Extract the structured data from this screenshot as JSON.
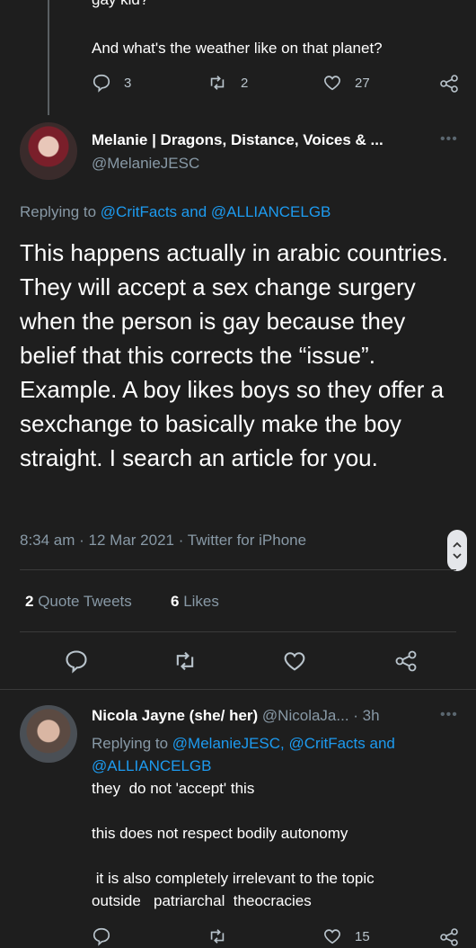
{
  "top_reply": {
    "partial_text": "gay kid?",
    "text": "And what's the weather like on that planet?",
    "replies": "3",
    "retweets": "2",
    "likes": "27"
  },
  "main_tweet": {
    "display_name": "Melanie | Dragons, Distance, Voices & ...",
    "handle": "@MelanieJESC",
    "replying_prefix": "Replying to",
    "replying_to_1": "@CritFacts",
    "replying_and": "and",
    "replying_to_2": "@ALLIANCELGB",
    "body": "This happens actually in arabic countries. They will accept a sex change surgery when the person is gay because they belief that this corrects the “issue”. Example. A boy likes boys so they offer a sexchange to basically make the boy straight. I search an article for you.",
    "timestamp": "8:34 am · 12 Mar 2021 · Twitter for iPhone",
    "quote_count": "2",
    "quote_label": "Quote Tweets",
    "likes_count": "6",
    "likes_label": "Likes"
  },
  "reply": {
    "display_name": "Nicola Jayne (she/ her)",
    "handle": "@NicolaJa...",
    "time": "· 3h",
    "replying_prefix": "Replying to",
    "replying_to_1": "@MelanieJESC,",
    "replying_to_2": "@CritFacts",
    "replying_and": "and",
    "replying_to_3": "@ALLIANCELGB",
    "line1": "they  do not 'accept' this",
    "line2": "this does not respect bodily autonomy",
    "line3": " it is also completely irrelevant to the topic",
    "line4": "outside   patriarchal  theocracies",
    "likes": "15"
  },
  "icons": [
    "reply-icon",
    "retweet-icon",
    "like-icon",
    "share-icon",
    "more-icon",
    "scroll-handle-icon"
  ],
  "colors": {
    "background": "#1e1e1e",
    "link": "#1d9bf0",
    "muted": "#8899a6"
  }
}
